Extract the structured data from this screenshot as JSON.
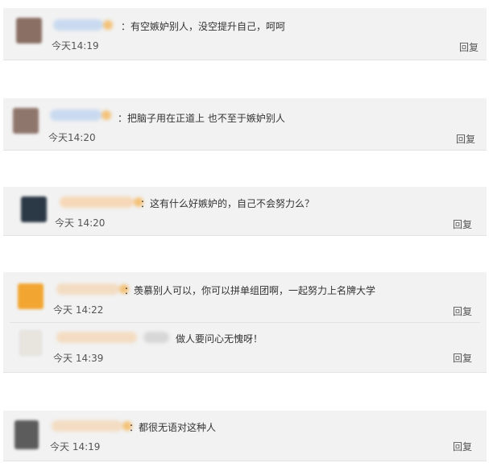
{
  "comments": [
    {
      "text": "：有空嫉妒别人，没空提升自己，呵呵",
      "time": "今天14:19",
      "reply": "回复"
    },
    {
      "text": "：把脑子用在正道上 也不至于嫉妒别人",
      "time": "今天14:20",
      "reply": "回复"
    },
    {
      "text": "：这有什么好嫉妒的，自己不会努力么？",
      "time": "今天 14:20",
      "reply": "回复"
    },
    {
      "text": "：羡慕别人可以，你可以拼单组团啊，一起努力上名牌大学",
      "time": "今天 14:22",
      "reply": "回复",
      "sub": {
        "text": "做人要问心无愧呀！",
        "time": "今天 14:39",
        "reply": "回复"
      }
    },
    {
      "text": "：都很无语对这种人",
      "time": "今天 14:19",
      "reply": "回复"
    }
  ]
}
